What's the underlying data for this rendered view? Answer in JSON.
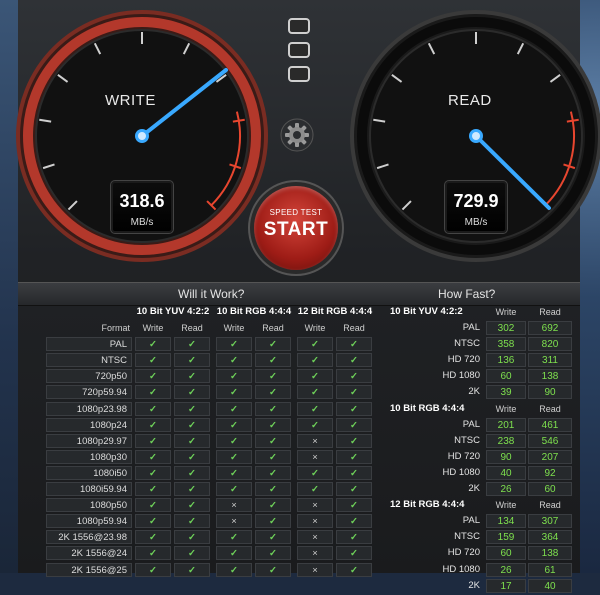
{
  "gauges": {
    "write": {
      "label": "WRITE",
      "value": "318.6",
      "unit": "MB/s"
    },
    "read": {
      "label": "READ",
      "value": "729.9",
      "unit": "MB/s"
    }
  },
  "start_button": {
    "small": "SPEED TEST",
    "big": "START"
  },
  "sections": {
    "left_title": "Will it Work?",
    "right_title": "How Fast?"
  },
  "will_it_work": {
    "groups": [
      "10 Bit YUV 4:2:2",
      "10 Bit RGB 4:4:4",
      "12 Bit RGB 4:4:4"
    ],
    "format_label": "Format",
    "write_label": "Write",
    "read_label": "Read",
    "rows": [
      {
        "format": "PAL",
        "vals": [
          1,
          1,
          1,
          1,
          1,
          1
        ]
      },
      {
        "format": "NTSC",
        "vals": [
          1,
          1,
          1,
          1,
          1,
          1
        ]
      },
      {
        "format": "720p50",
        "vals": [
          1,
          1,
          1,
          1,
          1,
          1
        ]
      },
      {
        "format": "720p59.94",
        "vals": [
          1,
          1,
          1,
          1,
          1,
          1
        ]
      },
      {
        "format": "1080p23.98",
        "vals": [
          1,
          1,
          1,
          1,
          1,
          1
        ]
      },
      {
        "format": "1080p24",
        "vals": [
          1,
          1,
          1,
          1,
          1,
          1
        ]
      },
      {
        "format": "1080p29.97",
        "vals": [
          1,
          1,
          1,
          1,
          0,
          1
        ]
      },
      {
        "format": "1080p30",
        "vals": [
          1,
          1,
          1,
          1,
          0,
          1
        ]
      },
      {
        "format": "1080i50",
        "vals": [
          1,
          1,
          1,
          1,
          1,
          1
        ]
      },
      {
        "format": "1080i59.94",
        "vals": [
          1,
          1,
          1,
          1,
          1,
          1
        ]
      },
      {
        "format": "1080p50",
        "vals": [
          1,
          1,
          0,
          1,
          0,
          1
        ]
      },
      {
        "format": "1080p59.94",
        "vals": [
          1,
          1,
          0,
          1,
          0,
          1
        ]
      },
      {
        "format": "2K 1556@23.98",
        "vals": [
          1,
          1,
          1,
          1,
          0,
          1
        ]
      },
      {
        "format": "2K 1556@24",
        "vals": [
          1,
          1,
          1,
          1,
          0,
          1
        ]
      },
      {
        "format": "2K 1556@25",
        "vals": [
          1,
          1,
          1,
          1,
          0,
          1
        ]
      }
    ],
    "symbols": {
      "ok": "✓",
      "no": "×"
    }
  },
  "how_fast": {
    "write_label": "Write",
    "read_label": "Read",
    "groups": [
      {
        "name": "10 Bit YUV 4:2:2",
        "rows": [
          {
            "fmt": "PAL",
            "w": "302",
            "r": "692"
          },
          {
            "fmt": "NTSC",
            "w": "358",
            "r": "820"
          },
          {
            "fmt": "HD 720",
            "w": "136",
            "r": "311"
          },
          {
            "fmt": "HD 1080",
            "w": "60",
            "r": "138"
          },
          {
            "fmt": "2K",
            "w": "39",
            "r": "90"
          }
        ]
      },
      {
        "name": "10 Bit RGB 4:4:4",
        "rows": [
          {
            "fmt": "PAL",
            "w": "201",
            "r": "461"
          },
          {
            "fmt": "NTSC",
            "w": "238",
            "r": "546"
          },
          {
            "fmt": "HD 720",
            "w": "90",
            "r": "207"
          },
          {
            "fmt": "HD 1080",
            "w": "40",
            "r": "92"
          },
          {
            "fmt": "2K",
            "w": "26",
            "r": "60"
          }
        ]
      },
      {
        "name": "12 Bit RGB 4:4:4",
        "rows": [
          {
            "fmt": "PAL",
            "w": "134",
            "r": "307"
          },
          {
            "fmt": "NTSC",
            "w": "159",
            "r": "364"
          },
          {
            "fmt": "HD 720",
            "w": "60",
            "r": "138"
          },
          {
            "fmt": "HD 1080",
            "w": "26",
            "r": "61"
          },
          {
            "fmt": "2K",
            "w": "17",
            "r": "40"
          }
        ]
      }
    ]
  },
  "colors": {
    "accent_green": "#6fd35a",
    "needle_blue": "#39a9ff",
    "start_red": "#c2312a",
    "redline": "#e8462f"
  }
}
